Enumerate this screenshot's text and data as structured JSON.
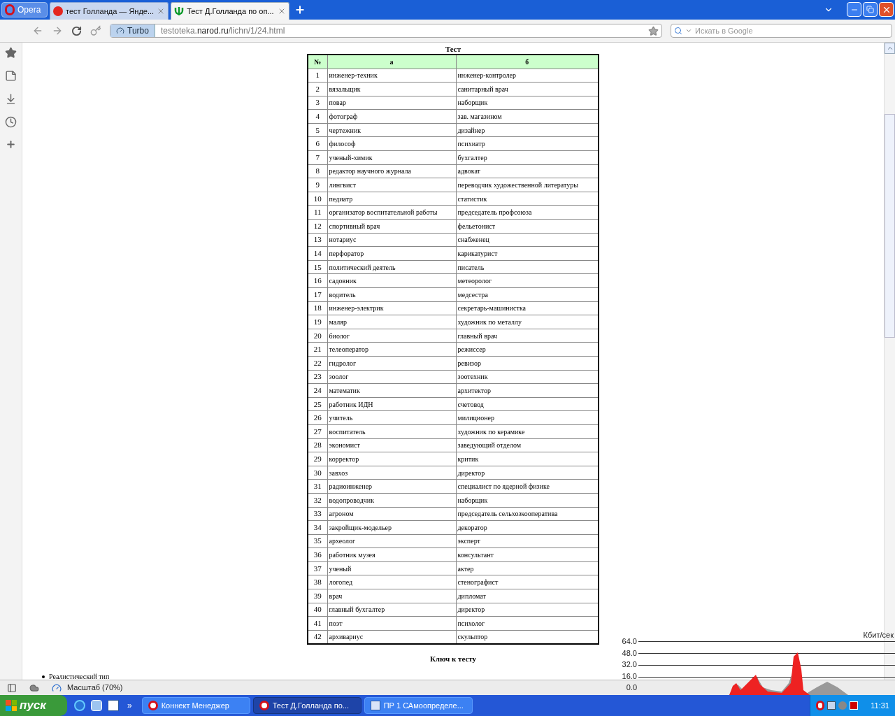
{
  "browser": {
    "menu_button": "Opera",
    "tabs": [
      {
        "title": "тест Голланда — Янде...",
        "kind": "search",
        "selected": false
      },
      {
        "title": "Тест Д.Голланда по оп...",
        "kind": "site",
        "selected": true
      }
    ],
    "turbo": "Turbo",
    "url": {
      "prefix": "testoteka.",
      "domain": "narod.ru",
      "path": "/lichn/1/24.html"
    },
    "search": {
      "placeholder": "Искать в Google"
    }
  },
  "page": {
    "title": "Тест",
    "columns": [
      "№",
      "а",
      "б"
    ],
    "rows": [
      {
        "n": "1",
        "a": "инженер-техник",
        "b": "инженер-контролер"
      },
      {
        "n": "2",
        "a": "вязальщик",
        "b": "санитарный врач"
      },
      {
        "n": "3",
        "a": "повар",
        "b": "наборщик"
      },
      {
        "n": "4",
        "a": "фотограф",
        "b": "зав. магазином"
      },
      {
        "n": "5",
        "a": "чертежник",
        "b": "дизайнер"
      },
      {
        "n": "6",
        "a": "философ",
        "b": "психиатр"
      },
      {
        "n": "7",
        "a": "ученый-химик",
        "b": "бухгалтер"
      },
      {
        "n": "8",
        "a": "редактор научного журнала",
        "b": "адвокат"
      },
      {
        "n": "9",
        "a": "лингвист",
        "b": "переводчик художественной литературы"
      },
      {
        "n": "10",
        "a": "педиатр",
        "b": "статистик"
      },
      {
        "n": "11",
        "a": "организатор воспитательной работы",
        "b": "председатель профсоюза"
      },
      {
        "n": "12",
        "a": "спортивный врач",
        "b": "фельетонист"
      },
      {
        "n": "13",
        "a": "нотариус",
        "b": "снабженец"
      },
      {
        "n": "14",
        "a": "перфоратор",
        "b": "карикатурист"
      },
      {
        "n": "15",
        "a": "политический деятель",
        "b": "писатель"
      },
      {
        "n": "16",
        "a": "садовник",
        "b": "метеоролог"
      },
      {
        "n": "17",
        "a": "водитель",
        "b": "медсестра"
      },
      {
        "n": "18",
        "a": "инженер-электрик",
        "b": "секретарь-машинистка"
      },
      {
        "n": "19",
        "a": "маляр",
        "b": "художник по металлу"
      },
      {
        "n": "20",
        "a": "биолог",
        "b": "главный врач"
      },
      {
        "n": "21",
        "a": "телеоператор",
        "b": "режиссер"
      },
      {
        "n": "22",
        "a": "гидролог",
        "b": "ревизор"
      },
      {
        "n": "23",
        "a": "зоолог",
        "b": "зоотехник"
      },
      {
        "n": "24",
        "a": "математик",
        "b": "архитектор"
      },
      {
        "n": "25",
        "a": "работник ИДН",
        "b": "счетовод"
      },
      {
        "n": "26",
        "a": "учитель",
        "b": "милиционер"
      },
      {
        "n": "27",
        "a": "воспитатель",
        "b": "художник по керамике"
      },
      {
        "n": "28",
        "a": "экономист",
        "b": "заведующий отделом"
      },
      {
        "n": "29",
        "a": "корректор",
        "b": "критик"
      },
      {
        "n": "30",
        "a": "завхоз",
        "b": "директор"
      },
      {
        "n": "31",
        "a": "радиоинженер",
        "b": "специалист по ядерной физике"
      },
      {
        "n": "32",
        "a": "водопроводчик",
        "b": "наборщик"
      },
      {
        "n": "33",
        "a": "агроном",
        "b": "председатель сельхозкооператива"
      },
      {
        "n": "34",
        "a": "закройщик-модельер",
        "b": "декоратор"
      },
      {
        "n": "35",
        "a": "археолог",
        "b": "эксперт"
      },
      {
        "n": "36",
        "a": "работник музея",
        "b": "консультант"
      },
      {
        "n": "37",
        "a": "ученый",
        "b": "актер"
      },
      {
        "n": "38",
        "a": "логопед",
        "b": "стенографист"
      },
      {
        "n": "39",
        "a": "врач",
        "b": "дипломат"
      },
      {
        "n": "40",
        "a": "главный бухгалтер",
        "b": "директор"
      },
      {
        "n": "41",
        "a": "поэт",
        "b": "психолог"
      },
      {
        "n": "42",
        "a": "архивариус",
        "b": "скульптор"
      }
    ],
    "key_heading": "Ключ к тесту",
    "bullets": [
      "Реалистический тип"
    ]
  },
  "traffic_monitor": {
    "unit": "Кбит/сек",
    "ticks": [
      "64.0",
      "48.0",
      "32.0",
      "16.0",
      "0.0"
    ]
  },
  "status_bar": {
    "zoom": "Масштаб (70%)"
  },
  "taskbar": {
    "start": "пуск",
    "more": "»",
    "tasks": [
      {
        "title": "Коннект Менеджер",
        "kind": "browser",
        "selected": false
      },
      {
        "title": "Тест Д.Голланда по...",
        "kind": "browser",
        "selected": true
      },
      {
        "title": "ПР 1 САмоопределе...",
        "kind": "document",
        "selected": false
      }
    ],
    "clock": "11:31"
  }
}
